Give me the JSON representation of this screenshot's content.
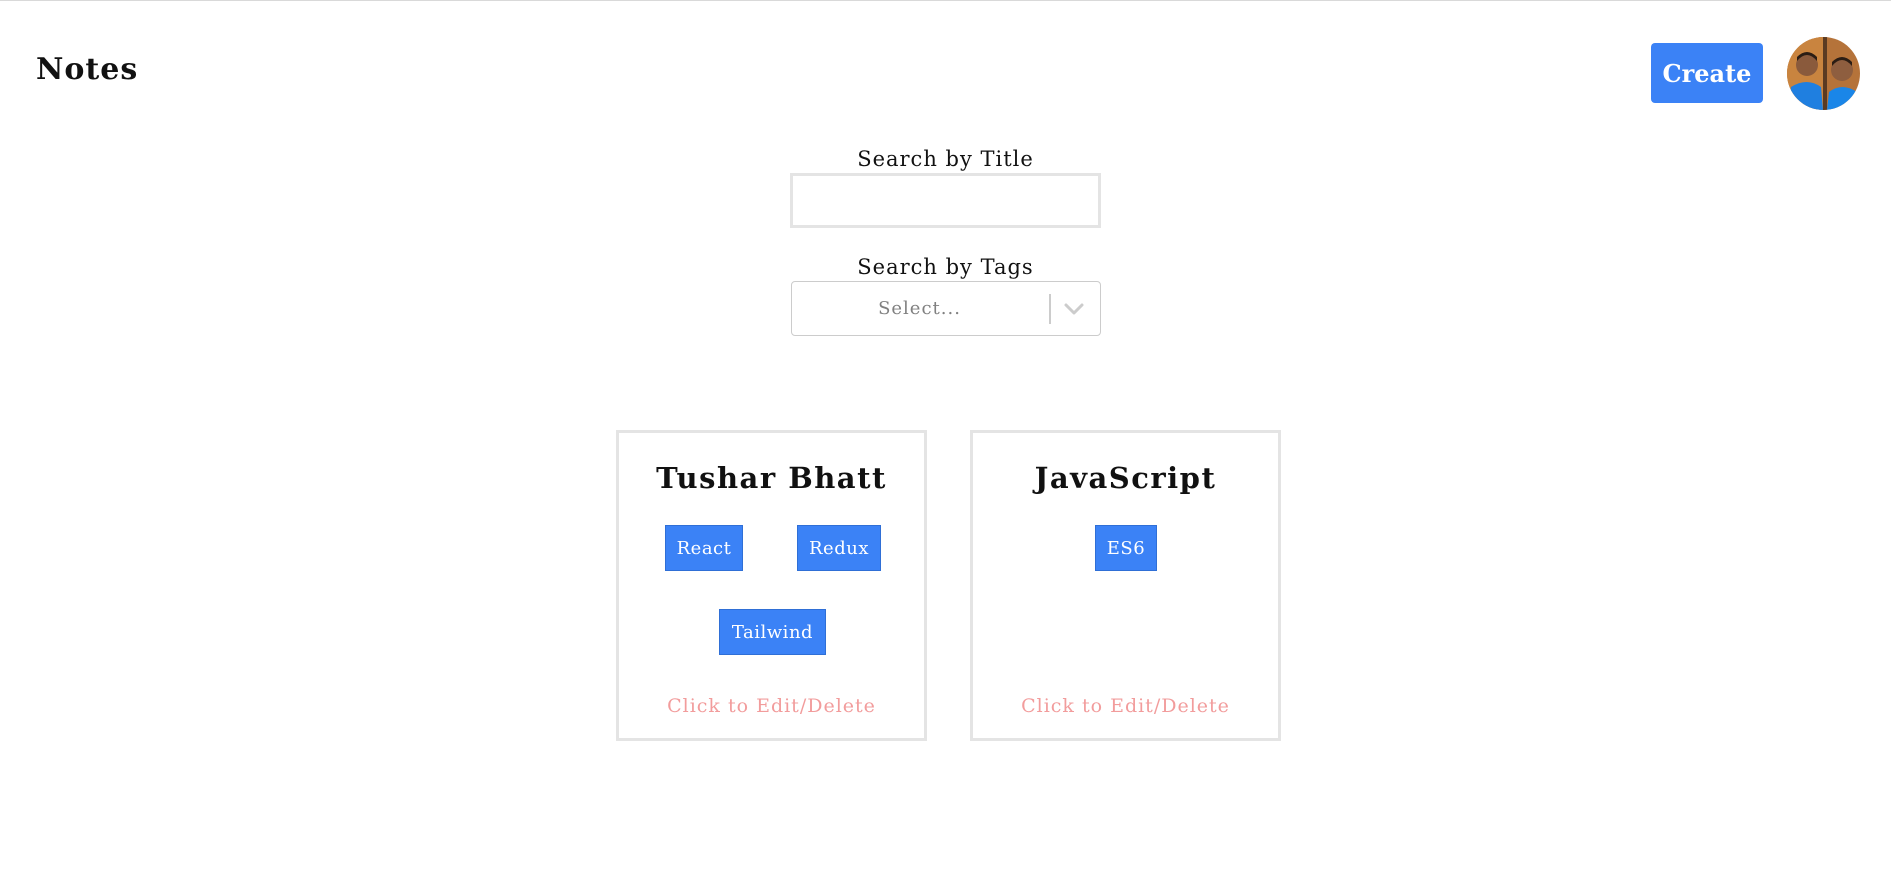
{
  "header": {
    "title": "Notes",
    "create_label": "Create"
  },
  "search": {
    "title_label": "Search by Title",
    "title_value": "",
    "tags_label": "Search by Tags",
    "tags_placeholder": "Select..."
  },
  "notes": [
    {
      "title": "Tushar Bhatt",
      "tags": [
        "React",
        "Redux",
        "Tailwind"
      ],
      "action": "Click to Edit/Delete"
    },
    {
      "title": "JavaScript",
      "tags": [
        "ES6"
      ],
      "action": "Click to Edit/Delete"
    }
  ],
  "colors": {
    "accent": "#3b82f6",
    "action_text": "#f29c9c",
    "border": "#e4e4e4"
  }
}
